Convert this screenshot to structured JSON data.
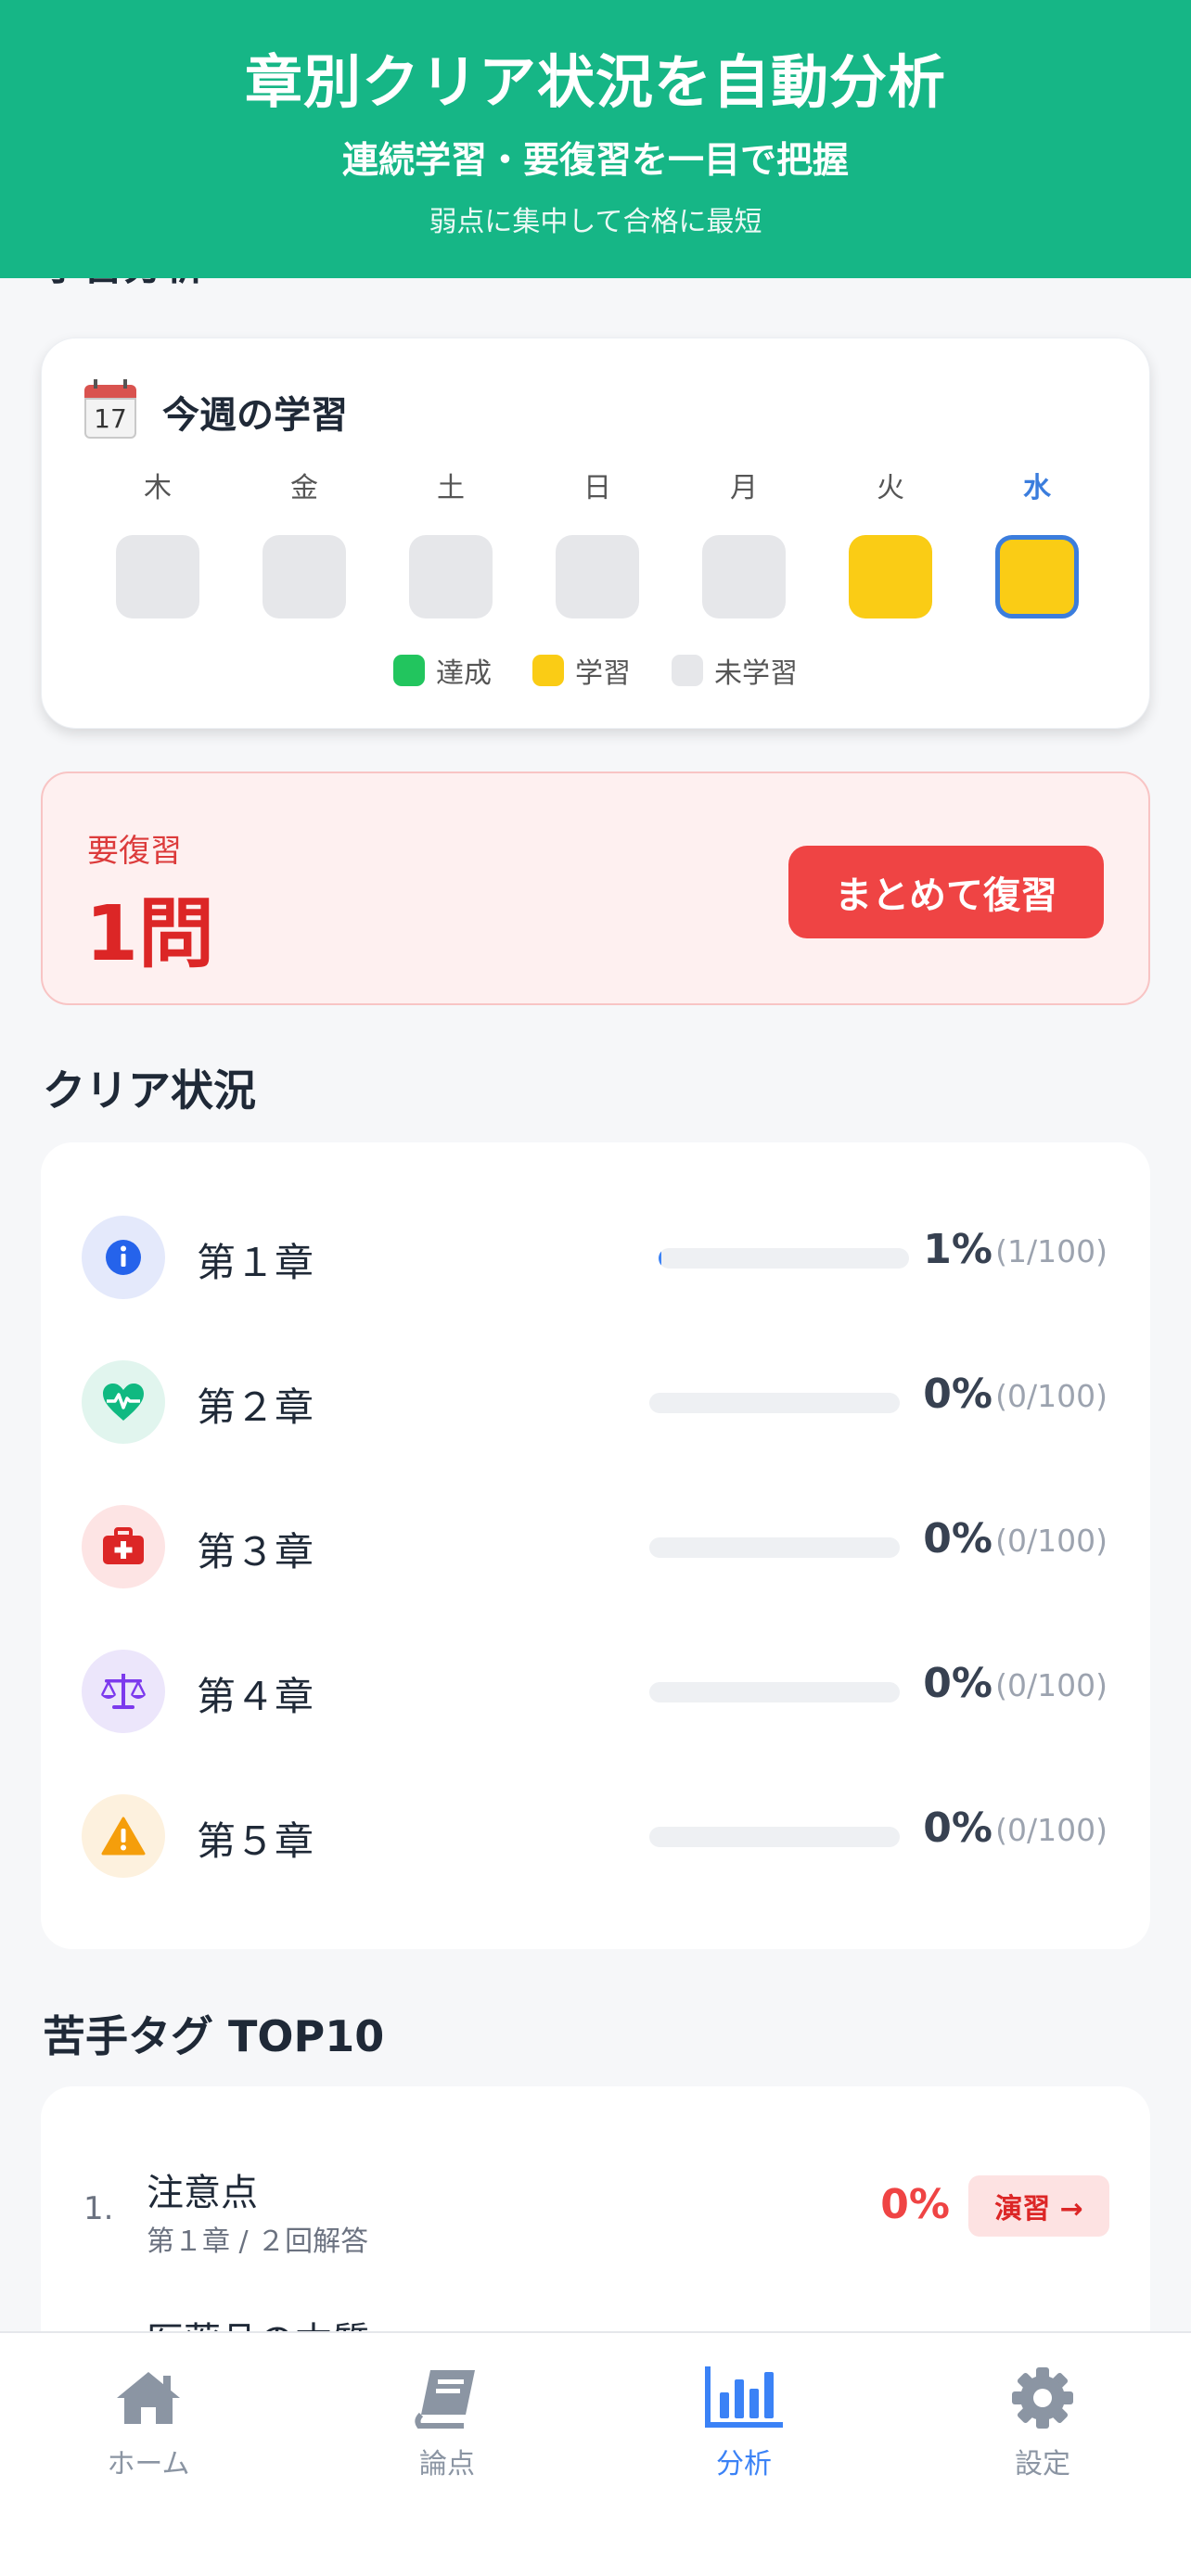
{
  "banner": {
    "title": "章別クリア状況を自動分析",
    "subtitle": "連続学習・要復習を一目で把握",
    "tagline": "弱点に集中して合格に最短"
  },
  "partial_section_title": "学習分析",
  "week": {
    "title": "今週の学習",
    "calendar_day": "17",
    "days": [
      {
        "label": "木",
        "status": "none"
      },
      {
        "label": "金",
        "status": "none"
      },
      {
        "label": "土",
        "status": "none"
      },
      {
        "label": "日",
        "status": "none"
      },
      {
        "label": "月",
        "status": "none"
      },
      {
        "label": "火",
        "status": "study"
      },
      {
        "label": "水",
        "status": "study",
        "today": true
      }
    ],
    "legend": [
      {
        "label": "達成",
        "color": "#22c55e"
      },
      {
        "label": "学習",
        "color": "#facc15"
      },
      {
        "label": "未学習",
        "color": "#e6e7ea"
      }
    ]
  },
  "review": {
    "label": "要復習",
    "count": "1問",
    "button": "まとめて復習"
  },
  "clear_status": {
    "title": "クリア状況",
    "chapters": [
      {
        "name": "第１章",
        "percent": "1%",
        "count": "(1/100)",
        "progress": 0.01,
        "icon": "info-icon",
        "icon_color": "#2563eb",
        "icon_bg": "#e4e9fb"
      },
      {
        "name": "第２章",
        "percent": "0%",
        "count": "(0/100)",
        "progress": 0,
        "icon": "heartbeat-icon",
        "icon_color": "#10b981",
        "icon_bg": "#e1f5ee"
      },
      {
        "name": "第３章",
        "percent": "0%",
        "count": "(0/100)",
        "progress": 0,
        "icon": "medical-kit-icon",
        "icon_color": "#dc2626",
        "icon_bg": "#fde4e4"
      },
      {
        "name": "第４章",
        "percent": "0%",
        "count": "(0/100)",
        "progress": 0,
        "icon": "scale-icon",
        "icon_color": "#7c3aed",
        "icon_bg": "#ece6fb"
      },
      {
        "name": "第５章",
        "percent": "0%",
        "count": "(0/100)",
        "progress": 0,
        "icon": "warning-icon",
        "icon_color": "#f59e0b",
        "icon_bg": "#fdf1de"
      }
    ]
  },
  "weak_tags": {
    "title": "苦手タグ TOP10",
    "items": [
      {
        "rank": "1.",
        "name": "注意点",
        "sub": "第１章 / ２回解答",
        "percent": "0%",
        "button": "演習 →"
      },
      {
        "rank": "2.",
        "name": "医薬品の本質",
        "sub": "",
        "percent": "",
        "button": ""
      }
    ]
  },
  "nav": {
    "items": [
      {
        "label": "ホーム",
        "icon": "home-icon"
      },
      {
        "label": "論点",
        "icon": "book-icon"
      },
      {
        "label": "分析",
        "icon": "bar-chart-icon",
        "active": true
      },
      {
        "label": "設定",
        "icon": "gear-icon"
      }
    ]
  }
}
